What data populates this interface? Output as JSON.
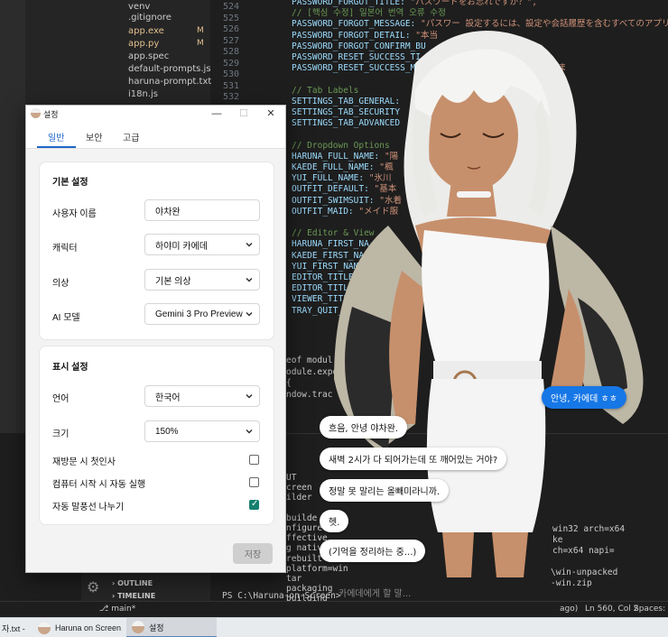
{
  "explorer": {
    "files": [
      {
        "name": "venv",
        "status": ""
      },
      {
        "name": ".gitignore",
        "status": ""
      },
      {
        "name": "app.exe",
        "status": "M"
      },
      {
        "name": "app.py",
        "status": "M"
      },
      {
        "name": "app.spec",
        "status": ""
      },
      {
        "name": "default-prompts.js",
        "status": ""
      },
      {
        "name": "haruna-prompt.txt",
        "status": ""
      },
      {
        "name": "i18n.js",
        "status": ""
      }
    ],
    "outline": "OUTLINE",
    "timeline": "TIMELINE"
  },
  "editor": {
    "line_numbers": [
      "524",
      "525",
      "526",
      "527",
      "528",
      "529",
      "530",
      "531",
      "532"
    ],
    "code_lines": [
      {
        "key": "PASSWORD_FORGOT_TITLE: ",
        "val": "\"パスワードをお忘れですか？\","
      },
      {
        "com": "// [핵심 수정] 일본어 번역 오류 수정"
      },
      {
        "key": "PASSWORD_FORGOT_MESSAGE: ",
        "val": "\"パスワー     設定するには、設定や会話履歴を含むすべてのアプリ"
      },
      {
        "key": "PASSWORD_FORGOT_DETAIL: ",
        "val": "\"本当"
      },
      {
        "key": "PASSWORD_FORGOT_CONFIRM_BU"
      },
      {
        "key": "PASSWORD_RESET_SUCCESS_TI"
      },
      {
        "key": "PASSWORD_RESET_SUCCESS_M",
        "val": "                  期化されました。アプリを再起動しま"
      },
      {
        "com": ""
      },
      {
        "com": "// Tab Labels"
      },
      {
        "key": "SETTINGS_TAB_GENERAL:"
      },
      {
        "key": "SETTINGS_TAB_SECURITY"
      },
      {
        "key": "SETTINGS_TAB_ADVANCED"
      },
      {
        "com": ""
      },
      {
        "com": "// Dropdown Options"
      },
      {
        "key": "HARUNA_FULL_NAME: ",
        "val": "\"陽"
      },
      {
        "key": "KAEDE_FULL_NAME: ",
        "val": "\"楓"
      },
      {
        "key": "YUI_FULL_NAME: ",
        "val": "\"氷川"
      },
      {
        "key": "OUTFIT_DEFAULT: ",
        "val": "\"基本"
      },
      {
        "key": "OUTFIT_SWIMSUIT: ",
        "val": "\"水着"
      },
      {
        "key": "OUTFIT_MAID: ",
        "val": "\"メイド服"
      },
      {
        "com": ""
      },
      {
        "com": "// Editor & View"
      },
      {
        "key": "HARUNA_FIRST_NA"
      },
      {
        "key": "KAEDE_FIRST_NA"
      },
      {
        "key": "YUI_FIRST_NAME"
      },
      {
        "key": "EDITOR_TITLE_"
      },
      {
        "key": "EDITOR_TITLE"
      },
      {
        "key": "VIEWER_TITL"
      },
      {
        "key": "TRAY_QUIT_"
      }
    ],
    "export_lines": [
      "eof modul",
      "odule.expor",
      "{",
      "ndow.trac"
    ]
  },
  "terminal": {
    "lines": [
      "UT",
      "creen",
      "ilder",
      "",
      "builde",
      "nfigure",
      "ffective",
      "g native",
      "rebuilt bin",
      "    platform=win",
      "    tar",
      "packaging",
      "  building"
    ],
    "right_fragments": [
      "win32 arch=x64",
      "ke",
      "ch=x64 napi=",
      "\\win-unpacked",
      "-win.zip"
    ],
    "prompt": "PS C:\\Haruna-on-Screen>"
  },
  "status_bar": {
    "branch": "main*",
    "ago": "ago)",
    "position": "Ln 560, Col 2",
    "spaces": "Spaces: 4"
  },
  "chat": {
    "user_message": "안녕, 카에데 ㅎㅎ",
    "replies": [
      "흐음, 안녕 야차완.",
      "새벽 2시가 다 되어가는데 또 깨어있는 거야?",
      "정말 못 말리는 올빼미라니까.",
      "헷.",
      "(기억을 정리하는 중...)"
    ],
    "input_placeholder": "카에데에게 할 말..."
  },
  "taskbar": {
    "items": [
      {
        "label": "자.txt -"
      },
      {
        "label": "Haruna on Screen"
      },
      {
        "label": "설정"
      }
    ]
  },
  "settings": {
    "title": "설정",
    "tabs": [
      "일반",
      "보안",
      "고급"
    ],
    "active_tab": "일반",
    "basic": {
      "heading": "기본 설정",
      "username_label": "사용자 이름",
      "username_value": "야차완",
      "character_label": "캐릭터",
      "character_value": "하야미 카에데",
      "outfit_label": "의상",
      "outfit_value": "기본 의상",
      "ai_model_label": "AI 모델",
      "ai_model_value": "Gemini 3 Pro Preview"
    },
    "display": {
      "heading": "표시 설정",
      "language_label": "언어",
      "language_value": "한국어",
      "size_label": "크기",
      "size_value": "150%",
      "greet_label": "재방문 시 첫인사",
      "greet_checked": false,
      "autostart_label": "컴퓨터 시작 시 자동 실행",
      "autostart_checked": false,
      "split_label": "자동 말풍선 나누기",
      "split_checked": true
    },
    "save_label": "저장"
  },
  "colors": {
    "accent": "#1f66c9",
    "check": "#16806f",
    "user_bubble": "#1677e6"
  }
}
